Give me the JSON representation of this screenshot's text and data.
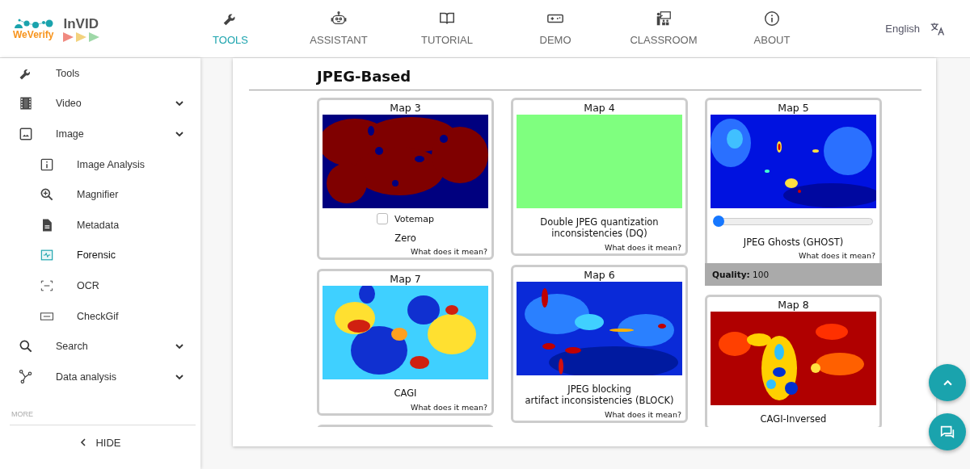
{
  "logos": {
    "weverify": "WeVerify",
    "invid": "InVID"
  },
  "nav": [
    {
      "label": "TOOLS",
      "selected": true
    },
    {
      "label": "ASSISTANT",
      "selected": false
    },
    {
      "label": "TUTORIAL",
      "selected": false
    },
    {
      "label": "DEMO",
      "selected": false
    },
    {
      "label": "CLASSROOM",
      "selected": false
    },
    {
      "label": "ABOUT",
      "selected": false
    }
  ],
  "language": "English",
  "sidebar": {
    "items": [
      {
        "kind": "link",
        "label": "Tools"
      },
      {
        "kind": "group",
        "label": "Video"
      },
      {
        "kind": "group",
        "label": "Image",
        "children": [
          {
            "label": "Image Analysis",
            "selected": false
          },
          {
            "label": "Magnifier",
            "selected": false
          },
          {
            "label": "Metadata",
            "selected": false
          },
          {
            "label": "Forensic",
            "selected": true
          },
          {
            "label": "OCR",
            "selected": false
          },
          {
            "label": "CheckGif",
            "selected": false
          }
        ]
      },
      {
        "kind": "group",
        "label": "Search"
      },
      {
        "kind": "group",
        "label": "Data analysis"
      }
    ],
    "section_label": "MORE",
    "hide_button": "HIDE"
  },
  "main": {
    "heading": "JPEG-Based",
    "columns": [
      [
        {
          "kind": "map",
          "title": "Map 3",
          "checkbox": {
            "label": "Votemap",
            "checked": false
          },
          "caption": "Zero",
          "help": "What does it mean?"
        },
        {
          "kind": "map",
          "title": "Map 7",
          "caption": "CAGI",
          "help": "What does it mean?"
        },
        {
          "kind": "partial"
        }
      ],
      [
        {
          "kind": "map",
          "title": "Map 4",
          "caption": "Double JPEG quantization inconsistencies (DQ)",
          "help": "What does it mean?"
        },
        {
          "kind": "map",
          "title": "Map 6",
          "caption": "JPEG blocking\nartifact inconsistencies (BLOCK)",
          "help": "What does it mean?"
        }
      ],
      [
        {
          "kind": "map",
          "title": "Map 5",
          "slider": {
            "level": 0
          },
          "caption": "JPEG Ghosts (GHOST)",
          "help": "What does it mean?",
          "footer": "**Quality:** 100"
        },
        {
          "kind": "map",
          "title": "Map 8",
          "caption": "CAGI-Inversed"
        }
      ]
    ]
  }
}
